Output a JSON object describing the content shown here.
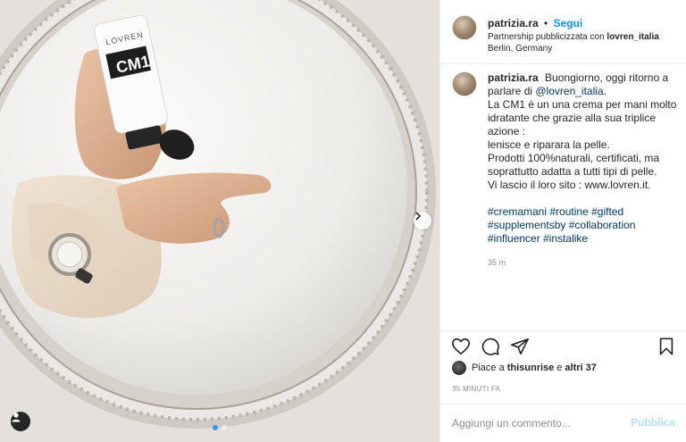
{
  "post": {
    "username": "patrizia.ra",
    "separator": "•",
    "follow_label": "Segui",
    "partnership_prefix": "Partnership pubblicizzata con",
    "partner_name": "lovren_italia",
    "location": "Berlin, Germany"
  },
  "caption": {
    "line_1": "Buongiorno, oggi ritorno a parlare di",
    "mention": "@lovren_italia",
    "line_1_end": ".",
    "line_2": "La CM1 è un una crema per mani molto idratante che grazie alla sua triplice azione :",
    "line_3": "lenisce e riparara la pelle.",
    "line_4": "Prodotti 100%naturali, certificati, ma soprattutto adatta a tutti tipi di pelle.",
    "line_5": "Vi lascio il loro sito : www.lovren.it.",
    "hashtags": [
      "#cremamani",
      "#routine",
      "#gifted",
      "#supplementsby",
      "#collaboration",
      "#influencer",
      "#instalike"
    ],
    "time": "35 m"
  },
  "product": {
    "brand_text": "LOVREN",
    "model_text": "CM1"
  },
  "likes": {
    "prefix": "Piace a",
    "first_liker": "thisunrise",
    "conjunction": "e",
    "others": "altri 37"
  },
  "posted_ago": "35 MINUTI FA",
  "comment": {
    "placeholder": "Aggiungi un commento...",
    "publish_label": "Pubblica"
  },
  "carousel": {
    "total": 2,
    "current": 1
  },
  "icons": {
    "like": "heart-icon",
    "comment": "comment-icon",
    "share": "paper-plane-icon",
    "save": "bookmark-icon",
    "next": "chevron-right-icon",
    "tag": "person-tag-icon"
  },
  "colors": {
    "link_blue": "#0095f6",
    "mention": "#00376b",
    "publish_disabled": "#b2dffc",
    "active_dot": "#3897f0"
  }
}
